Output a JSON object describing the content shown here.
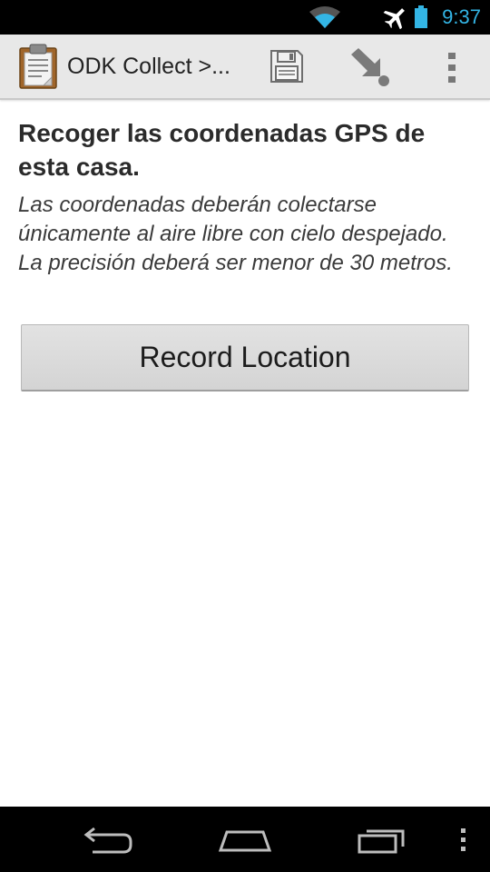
{
  "status_bar": {
    "time": "9:37",
    "icons": [
      "wifi-icon",
      "airplane-mode-icon",
      "battery-icon"
    ],
    "accent_color": "#33b5e5"
  },
  "action_bar": {
    "title": "ODK Collect >...",
    "icons": [
      "clipboard-app-icon",
      "save-icon",
      "jump-to-icon",
      "overflow-menu-icon"
    ]
  },
  "question": {
    "label": "Recoger las coordenadas GPS de esta casa.",
    "hint": "Las coordenadas deberán colectarse únicamente al aire libre con cielo despejado. La precisión deberá ser menor de 30 metros."
  },
  "record_button": {
    "label": "Record Location"
  },
  "nav_bar": {
    "icons": [
      "back-icon",
      "home-icon",
      "recent-apps-icon",
      "menu-icon"
    ]
  }
}
